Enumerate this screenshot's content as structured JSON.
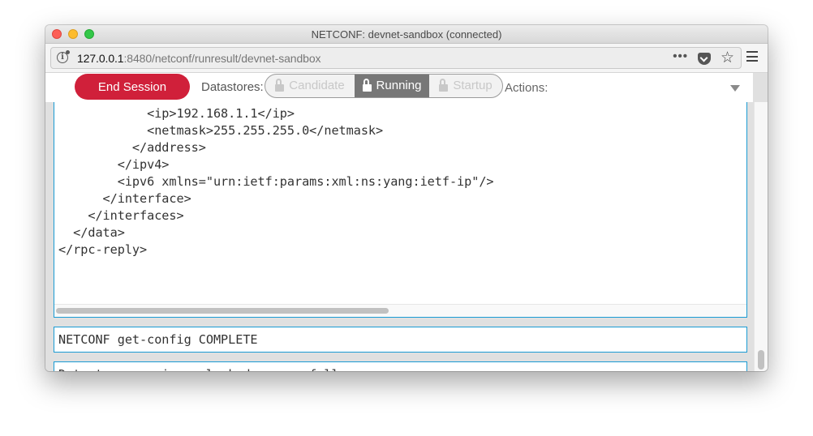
{
  "window": {
    "title": "NETCONF: devnet-sandbox (connected)"
  },
  "browser": {
    "url_host": "127.0.0.1",
    "url_rest": ":8480/netconf/runresult/devnet-sandbox",
    "icons": {
      "site_info": "info-icon",
      "more": "more-actions-icon",
      "pocket": "pocket-icon",
      "bookmark": "star-icon",
      "menu": "hamburger-menu-icon"
    },
    "more_label": "•••",
    "star_glyph": "☆"
  },
  "toolbar": {
    "end_session_label": "End Session",
    "datastores_label": "Datastores:",
    "datastores": [
      {
        "label": "Candidate",
        "state": "disabled",
        "icon": "unlock-icon"
      },
      {
        "label": "Running",
        "state": "selected",
        "icon": "unlock-icon"
      },
      {
        "label": "Startup",
        "state": "disabled",
        "icon": "unlock-icon"
      }
    ],
    "actions_label": "Actions:",
    "accent_color": "#d0203a"
  },
  "output": {
    "lines": [
      "            <ip>192.168.1.1</ip>",
      "            <netmask>255.255.255.0</netmask>",
      "          </address>",
      "        </ipv4>",
      "        <ipv6 xmlns=\"urn:ietf:params:xml:ns:yang:ietf-ip\"/>",
      "      </interface>",
      "    </interfaces>",
      "  </data>",
      "</rpc-reply>"
    ],
    "border_color": "#1a9bd4"
  },
  "status_messages": [
    "NETCONF get-config COMPLETE",
    "Datastore running unlocked successfully"
  ]
}
